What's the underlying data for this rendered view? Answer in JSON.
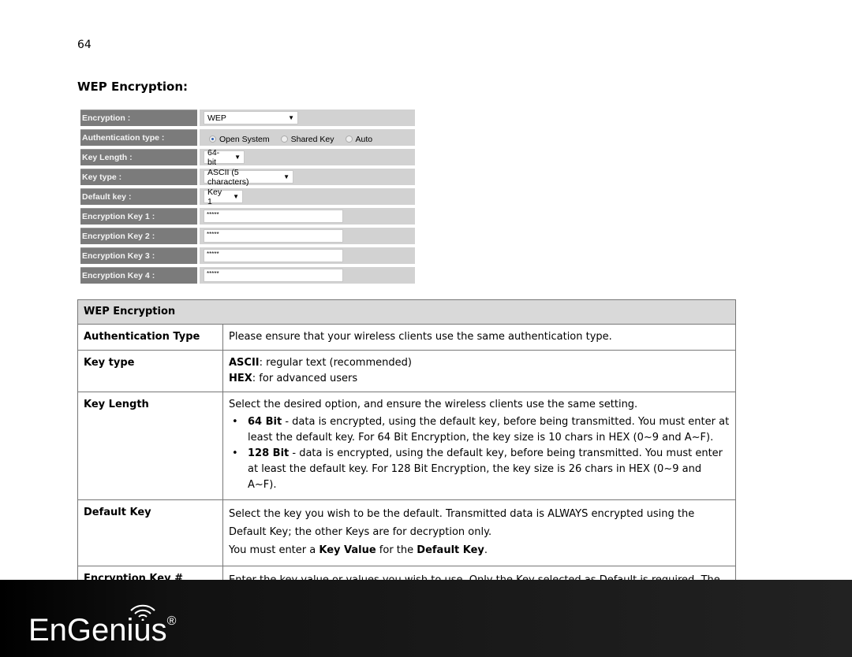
{
  "page_number": "64",
  "heading": "WEP Encryption:",
  "form": {
    "encryption": {
      "label": "Encryption :",
      "value": "WEP"
    },
    "auth": {
      "label": "Authentication type :",
      "options": [
        "Open System",
        "Shared Key",
        "Auto"
      ],
      "selected": "Open System"
    },
    "key_length": {
      "label": "Key Length :",
      "value": "64-bit"
    },
    "key_type": {
      "label": "Key type :",
      "value": "ASCII (5 characters)"
    },
    "default_key": {
      "label": "Default key :",
      "value": "Key 1"
    },
    "keys": [
      {
        "label": "Encryption Key 1 :",
        "value": "*****"
      },
      {
        "label": "Encryption Key 2 :",
        "value": "*****"
      },
      {
        "label": "Encryption Key 3 :",
        "value": "*****"
      },
      {
        "label": "Encryption Key 4 :",
        "value": "*****"
      }
    ]
  },
  "table": {
    "header": "WEP Encryption",
    "auth": {
      "term": "Authentication Type",
      "desc": "Please ensure that your wireless clients use the same authentication type."
    },
    "key_type": {
      "term": "Key type",
      "ascii_b": "ASCII",
      "ascii": ": regular text (recommended)",
      "hex_b": "HEX",
      "hex": ": for advanced users"
    },
    "key_length": {
      "term": "Key Length",
      "intro": "Select the desired option, and ensure the wireless clients use the same setting.",
      "b1": "64 Bit",
      "t1": " - data is encrypted, using the default key, before being transmitted. You must enter at least the default key. For 64 Bit Encryption, the key size is 10 chars in HEX (0~9 and A~F).",
      "b2": "128 Bit",
      "t2": " - data is encrypted, using the default key, before being transmitted. You must enter at least the default key. For 128 Bit Encryption, the key size is 26 chars in HEX (0~9 and A~F)."
    },
    "default_key": {
      "term": "Default Key",
      "line1": "Select the key you wish to be the default. Transmitted data is ALWAYS encrypted using the Default Key; the other Keys are for decryption only.",
      "l2a": "You must enter a ",
      "l2b": "Key Value",
      "l2c": " for the ",
      "l2d": "Default Key",
      "l2e": "."
    },
    "enc_key": {
      "term": "Encryption Key #",
      "desc": "Enter the key value or values you wish to use. Only the Key selected as Default is required. The others are optional."
    }
  },
  "footer": {
    "logo": "EnGenius",
    "reg": "®",
    "logo_icon": "wifi-icon"
  }
}
